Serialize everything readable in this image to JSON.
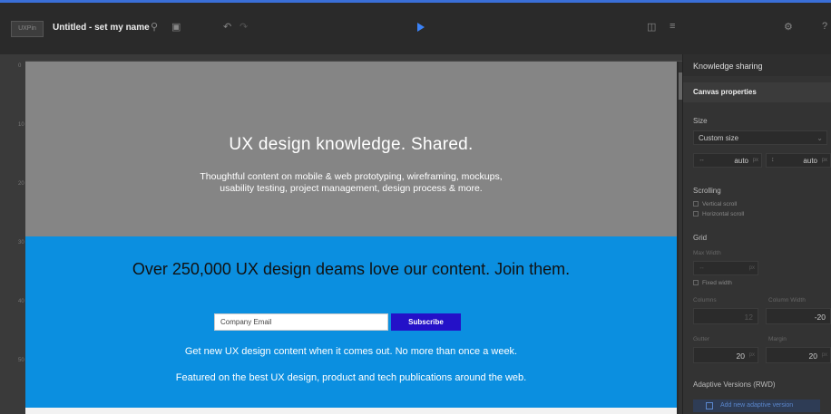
{
  "topbar": {
    "logo_text": "UXPin",
    "title": "Untitled - set my name",
    "icons": [
      "search-icon",
      "frame-icon",
      "undo-icon",
      "redo-icon",
      "play-icon",
      "save-icon",
      "settings-sliders-icon",
      "gear-icon",
      "help-icon"
    ],
    "accent_color": "#3a6fd8"
  },
  "ruler": {
    "marks": [
      "0",
      "10",
      "20",
      "30",
      "40",
      "50"
    ]
  },
  "canvas": {
    "hero": {
      "heading": "UX design knowledge. Shared.",
      "line1": "Thoughtful content on mobile & web prototyping, wireframing, mockups,",
      "line2": "usability testing, project management, design process & more."
    },
    "band": {
      "heading": "Over 250,000 UX design deams love our content. Join them.",
      "email_placeholder": "Company Email",
      "subscribe_label": "Subscribe",
      "line1": "Get new UX design content when it comes out. No more than once a week.",
      "line2": "Featured on the best UX design, product and tech publications around the web."
    },
    "colors": {
      "hero": "#858585",
      "band": "#0b8fe0",
      "button": "#2411c8"
    }
  },
  "panel": {
    "header": "Knowledge sharing",
    "subheader": "Canvas properties",
    "size": {
      "label": "Size",
      "preset": "Custom size",
      "width": "auto",
      "height": "auto",
      "unit": "px"
    },
    "scrolling": {
      "label": "Scrolling",
      "vertical": "Vertical scroll",
      "horizontal": "Horizontal scroll"
    },
    "grid": {
      "label": "Grid",
      "max_width_label": "Max Width",
      "fixed_width": "Fixed width",
      "columns_label": "Columns",
      "column_width_label": "Column Width",
      "columns_value": "12",
      "column_width_value": "-20",
      "gutter_label": "Gutter",
      "margin_label": "Margin",
      "gutter_value": "20",
      "margin_value": "20"
    },
    "adaptive": {
      "label": "Adaptive Versions (RWD)",
      "add_label": "Add new adaptive version"
    }
  }
}
